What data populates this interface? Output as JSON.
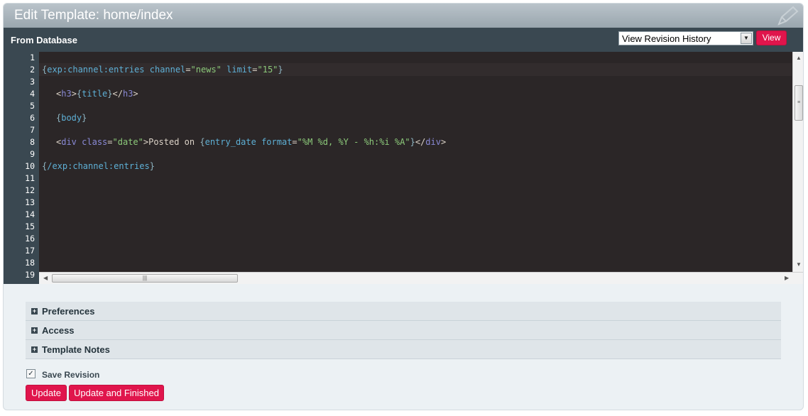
{
  "title": "Edit Template: home/index",
  "source_label": "From Database",
  "revision": {
    "selected": "View Revision History",
    "view_button": "View"
  },
  "editor": {
    "line_numbers": [
      "1",
      "2",
      "3",
      "4",
      "5",
      "6",
      "7",
      "8",
      "9",
      "10",
      "11",
      "12",
      "13",
      "14",
      "15",
      "16",
      "17",
      "18",
      "19"
    ]
  },
  "sections": [
    "Preferences",
    "Access",
    "Template Notes"
  ],
  "save_revision_label": "Save Revision",
  "save_revision_checked": true,
  "buttons": {
    "update": "Update",
    "update_finished": "Update and Finished"
  },
  "colors": {
    "accent_red": "#e0154c",
    "header_dark": "#3a4851",
    "editor_bg": "#2b2627"
  },
  "code_tokens": {
    "l2": [
      "{",
      "exp:channel:entries",
      " channel",
      "=",
      "\"news\"",
      " limit",
      "=",
      "\"15\"",
      "}"
    ],
    "l4": [
      "<",
      "h3",
      ">",
      "{",
      "title",
      "}",
      "</",
      "h3",
      ">"
    ],
    "l6": [
      "{",
      "body",
      "}"
    ],
    "l8": [
      "<",
      "div",
      " class",
      "=",
      "\"date\"",
      ">",
      "Posted on ",
      "{",
      "entry_date",
      " format",
      "=",
      "\"%M %d, %Y - %h:%i %A\"",
      "}",
      "</",
      "div",
      ">"
    ],
    "l10": [
      "{",
      "/exp:channel:entries",
      "}"
    ]
  }
}
